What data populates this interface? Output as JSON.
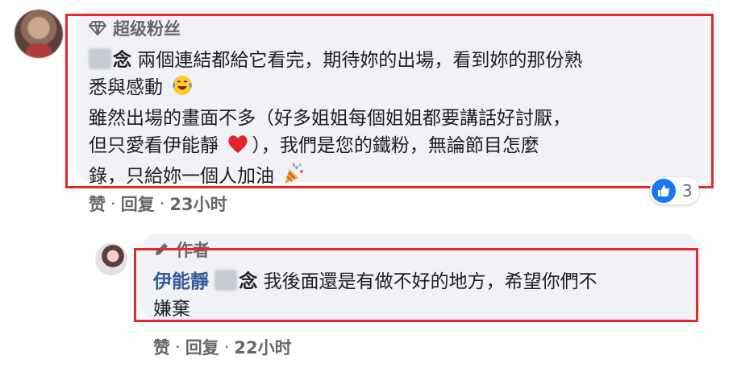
{
  "main_comment": {
    "badge": "超级粉丝",
    "author_suffix": "念",
    "lines": [
      "兩個連結都給它看完，期待妳的出場，看到妳的那份熟",
      "悉與感動",
      "雖然出場的畫面不多（好多姐姐每個姐姐都要講話好討厭，",
      "但只愛看伊能靜",
      "），我們是您的鐵粉，無論節目怎麼",
      "錄，只給妳一個人加油"
    ],
    "meta": {
      "like": "赞",
      "reply": "回复",
      "time": "23小时",
      "separator": "·"
    },
    "reaction_count": "3"
  },
  "reply_comment": {
    "badge": "作者",
    "author": "伊能靜",
    "mention_suffix": "念",
    "lines": [
      "我後面還是有做不好的地方，希望你們不",
      "嫌棄"
    ],
    "meta": {
      "like": "赞",
      "reply": "回复",
      "time": "22小时",
      "separator": "·"
    }
  },
  "icons": {
    "badge_main": "diamond-icon",
    "badge_reply": "pencil-icon",
    "emoji_laugh": "tears-of-joy-icon",
    "emoji_heart": "red-heart-icon",
    "emoji_party": "party-popper-icon",
    "reaction": "like-icon"
  },
  "colors": {
    "highlight_box": "#e8262c",
    "bubble": "#f0f2f5",
    "like_blue": "#1877f2",
    "link_blue": "#385898"
  }
}
